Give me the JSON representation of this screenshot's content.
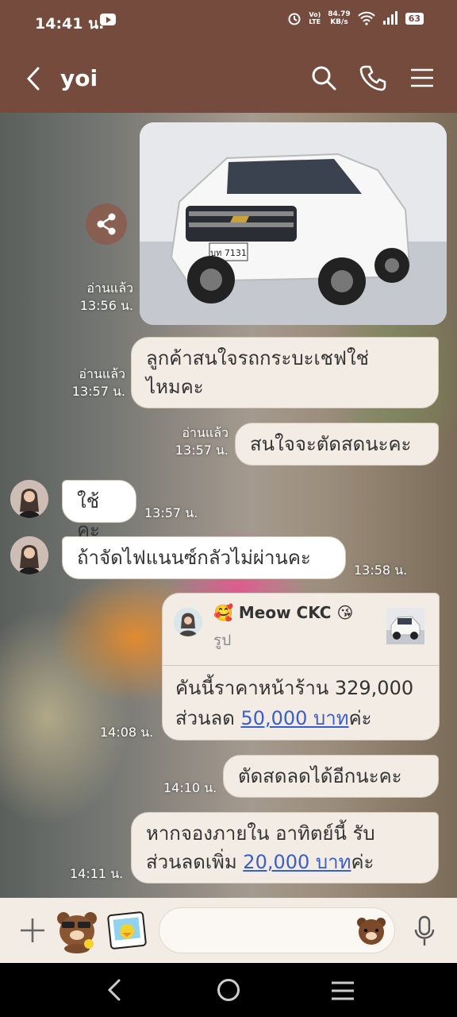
{
  "status_bar": {
    "time": "14:41 น.",
    "network_top": "Vo)",
    "network_bottom": "LTE",
    "speed_value": "84.79",
    "speed_unit": "KB/s",
    "battery": "63"
  },
  "header": {
    "title": "yoi"
  },
  "messages": {
    "m1": {
      "read": "อ่านแล้ว",
      "time": "13:56 น."
    },
    "m2": {
      "text_line1": "ลูกค้าสนใจรถกระบะเชฟใช่",
      "text_line2": "ไหมคะ",
      "read": "อ่านแล้ว",
      "time": "13:57 น."
    },
    "m3": {
      "text": "สนใจจะตัดสดนะคะ",
      "read": "อ่านแล้ว",
      "time": "13:57 น."
    },
    "m4": {
      "text": "ใช้คะ",
      "time": "13:57 น."
    },
    "m5": {
      "text": "ถ้าจัดไฟแนนซ์กลัวไม่ผ่านคะ",
      "time": "13:58 น."
    },
    "m6": {
      "quote_name": "Meow CKC",
      "quote_emoji_left": "🥰",
      "quote_emoji_right": "😘",
      "quote_sub": "รูป",
      "line1": "คันนี้ราคาหน้าร้าน 329,000",
      "line2_prefix": "ส่วนลด ",
      "line2_link": "50,000 บาท",
      "line2_suffix": "ค่ะ",
      "time": "14:08 น."
    },
    "m7": {
      "text": "ตัดสดลดได้อีกนะคะ",
      "time": "14:10 น."
    },
    "m8": {
      "line1": "หากจองภายใน อาทิตย์นี้ รับ",
      "line2_prefix": "ส่วนลดเพิ่ม ",
      "line2_link": "20,000 บาท",
      "line2_suffix": "ค่ะ",
      "time": "14:11 น."
    }
  },
  "car_plate": "บท 7131",
  "input": {
    "placeholder": ""
  },
  "colors": {
    "header": "#744b3c",
    "bubble": "#f3ece4",
    "link": "#3a5fc9"
  }
}
